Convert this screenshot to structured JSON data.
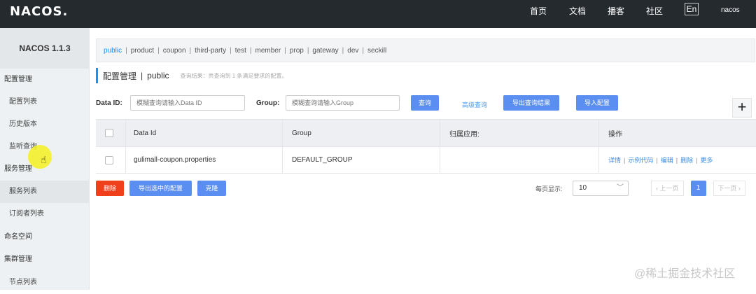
{
  "topbar": {
    "logo": "NACOS.",
    "nav": [
      "首页",
      "文档",
      "播客",
      "社区"
    ],
    "lang": "En",
    "user": "nacos"
  },
  "sidebar": {
    "title": "NACOS 1.1.3",
    "items": [
      {
        "label": "配置管理",
        "type": "group"
      },
      {
        "label": "配置列表",
        "type": "sub"
      },
      {
        "label": "历史版本",
        "type": "sub"
      },
      {
        "label": "监听查询",
        "type": "sub"
      },
      {
        "label": "服务管理",
        "type": "group"
      },
      {
        "label": "服务列表",
        "type": "sub",
        "active": true
      },
      {
        "label": "订阅者列表",
        "type": "sub"
      },
      {
        "label": "命名空间",
        "type": "group"
      },
      {
        "label": "集群管理",
        "type": "group"
      },
      {
        "label": "节点列表",
        "type": "sub"
      }
    ]
  },
  "namespaces": {
    "tabs": [
      "public",
      "product",
      "coupon",
      "third-party",
      "test",
      "member",
      "prop",
      "gateway",
      "dev",
      "seckill"
    ],
    "active": "public",
    "separator": "|"
  },
  "page": {
    "title": "配置管理",
    "pipe": "|",
    "namespace": "public",
    "hint": "查询结果：共查询到 1 条满足要求的配置。"
  },
  "search": {
    "dataid_label": "Data ID:",
    "dataid_placeholder": "模糊查询请输入Data ID",
    "group_label": "Group:",
    "group_placeholder": "模糊查询请输入Group",
    "query_button": "查询",
    "advanced_link": "高级查询",
    "export_button": "导出查询结果",
    "import_button": "导入配置",
    "add_symbol": "+"
  },
  "table": {
    "headers": [
      "Data Id",
      "Group",
      "归属应用:",
      "操作"
    ],
    "rows": [
      {
        "data_id": "gulimall-coupon.properties",
        "group": "DEFAULT_GROUP",
        "app": "",
        "ops": [
          "详情",
          "示例代码",
          "编辑",
          "删除",
          "更多"
        ]
      }
    ]
  },
  "footer": {
    "delete_button": "删除",
    "export_selected_button": "导出选中的配置",
    "clone_button": "克隆",
    "page_size_label": "每页显示:",
    "page_size": "10",
    "prev": "上一页",
    "current_page": "1",
    "next": "下一页"
  },
  "watermark": "@稀土掘金技术社区",
  "colors": {
    "topbar": "#252a2f",
    "accent": "#5a8ef0",
    "danger": "#f0401b",
    "link": "#3a8ee6"
  }
}
